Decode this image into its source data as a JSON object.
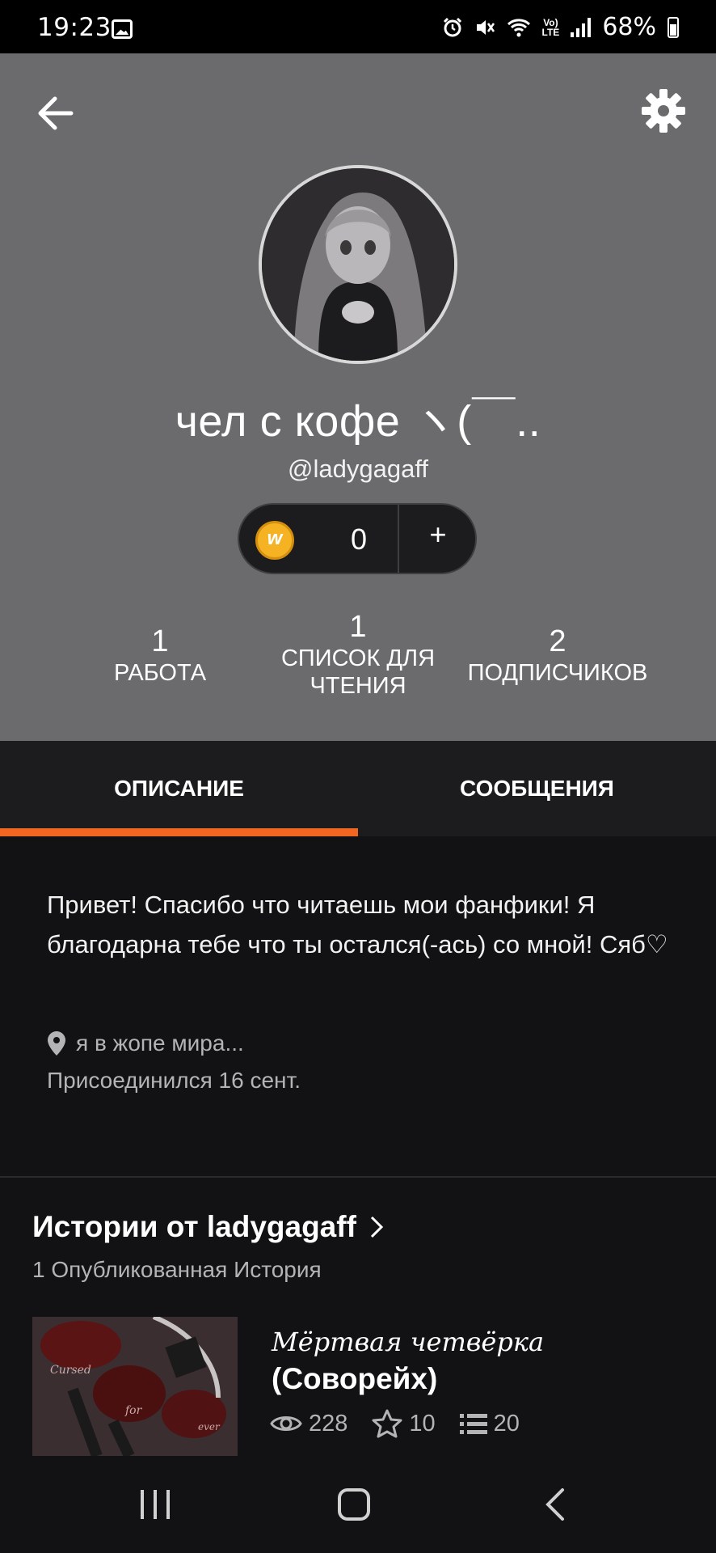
{
  "status_bar": {
    "time": "19:23",
    "battery": "68%",
    "network": "Vo)\nLTE",
    "icons": [
      "gallery-icon",
      "alarm-icon",
      "mute-icon",
      "wifi-icon",
      "signal-icon",
      "battery-icon"
    ]
  },
  "header": {
    "back_icon": "arrow-left-icon",
    "settings_icon": "gear-icon",
    "display_name": "чел с кофе ヽ(￣..",
    "username": "@ladygagaff",
    "coins": {
      "count": "0",
      "plus": "+"
    },
    "stats": [
      {
        "value": "1",
        "label": "РАБОТА"
      },
      {
        "value": "1",
        "label": "СПИСОК ДЛЯ ЧТЕНИЯ"
      },
      {
        "value": "2",
        "label": "ПОДПИСЧИКОВ"
      }
    ]
  },
  "tabs": [
    {
      "label": "ОПИСАНИЕ",
      "active": true
    },
    {
      "label": "СООБЩЕНИЯ",
      "active": false
    }
  ],
  "about": {
    "description": "Привет! Спасибо что читаешь мои фанфики! Я благодарна тебе что ты остался(-ась) со мной! Сяб♡",
    "location": "я в жопе мира...",
    "joined": "Присоединился 16 сент."
  },
  "stories": {
    "title": "Истории от ladygagaff",
    "subtitle": "1 Опубликованная История",
    "items": [
      {
        "title_script": "Мёртвая четвёрка",
        "title": "(Соворейх)",
        "cover_words": [
          "Cursed",
          "for",
          "ever"
        ],
        "views": "228",
        "votes": "10",
        "parts": "20"
      }
    ]
  },
  "colors": {
    "accent": "#f16722",
    "header_bg": "#6b6a6d",
    "dark_bg": "#121113",
    "tab_bg": "#1c1b1e",
    "coin": "#f5b324"
  }
}
